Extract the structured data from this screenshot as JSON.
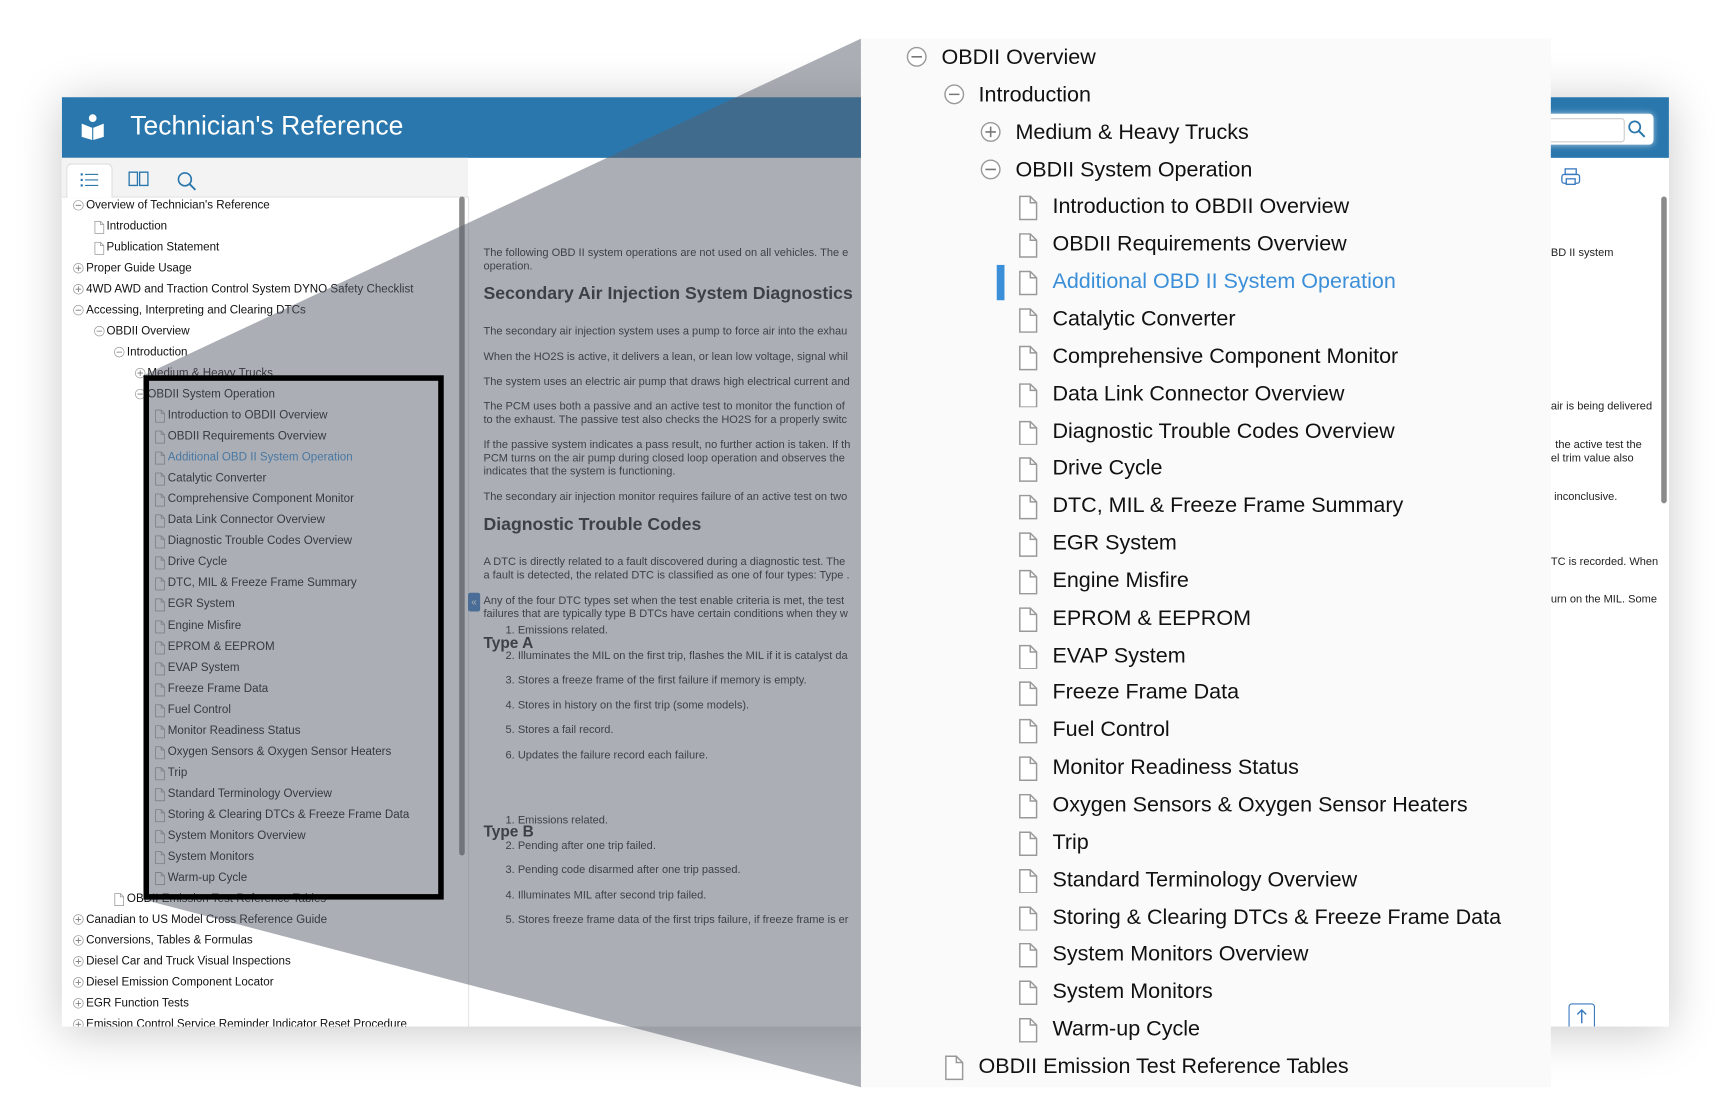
{
  "app": {
    "title": "Technician's Reference",
    "accent": "#2a77ad",
    "selected_color": "#3b8fd9"
  },
  "toolbar": {
    "tabs": [
      {
        "icon": "list-icon",
        "active": true
      },
      {
        "icon": "book-icon"
      },
      {
        "icon": "search-icon"
      }
    ]
  },
  "tree": [
    {
      "label": "Overview of Technician's Reference",
      "level": 0,
      "icon": "minus"
    },
    {
      "label": "Introduction",
      "level": 1,
      "icon": "doc"
    },
    {
      "label": "Publication Statement",
      "level": 1,
      "icon": "doc"
    },
    {
      "label": "Proper Guide Usage",
      "level": 0,
      "icon": "plus"
    },
    {
      "label": "4WD AWD and Traction Control System DYNO Safety Checklist",
      "level": 0,
      "icon": "plus"
    },
    {
      "label": "Accessing, Interpreting and Clearing DTCs",
      "level": 0,
      "icon": "minus"
    },
    {
      "label": "OBDII Overview",
      "level": 1,
      "icon": "minus"
    },
    {
      "label": "Introduction",
      "level": 2,
      "icon": "minus"
    },
    {
      "label": "Medium & Heavy Trucks",
      "level": 3,
      "icon": "plus"
    },
    {
      "label": "OBDII System Operation",
      "level": 3,
      "icon": "minus"
    },
    {
      "label": "Introduction to OBDII Overview",
      "level": 4,
      "icon": "doc"
    },
    {
      "label": "OBDII Requirements Overview",
      "level": 4,
      "icon": "doc"
    },
    {
      "label": "Additional OBD II System Operation",
      "level": 4,
      "icon": "doc",
      "selected": true
    },
    {
      "label": "Catalytic Converter",
      "level": 4,
      "icon": "doc"
    },
    {
      "label": "Comprehensive Component Monitor",
      "level": 4,
      "icon": "doc"
    },
    {
      "label": "Data Link Connector Overview",
      "level": 4,
      "icon": "doc"
    },
    {
      "label": "Diagnostic Trouble Codes Overview",
      "level": 4,
      "icon": "doc"
    },
    {
      "label": "Drive Cycle",
      "level": 4,
      "icon": "doc"
    },
    {
      "label": "DTC, MIL & Freeze Frame Summary",
      "level": 4,
      "icon": "doc"
    },
    {
      "label": "EGR System",
      "level": 4,
      "icon": "doc"
    },
    {
      "label": "Engine Misfire",
      "level": 4,
      "icon": "doc"
    },
    {
      "label": "EPROM & EEPROM",
      "level": 4,
      "icon": "doc"
    },
    {
      "label": "EVAP System",
      "level": 4,
      "icon": "doc"
    },
    {
      "label": "Freeze Frame Data",
      "level": 4,
      "icon": "doc"
    },
    {
      "label": "Fuel Control",
      "level": 4,
      "icon": "doc"
    },
    {
      "label": "Monitor Readiness Status",
      "level": 4,
      "icon": "doc"
    },
    {
      "label": "Oxygen Sensors & Oxygen Sensor Heaters",
      "level": 4,
      "icon": "doc"
    },
    {
      "label": "Trip",
      "level": 4,
      "icon": "doc"
    },
    {
      "label": "Standard Terminology Overview",
      "level": 4,
      "icon": "doc"
    },
    {
      "label": "Storing & Clearing DTCs & Freeze Frame Data",
      "level": 4,
      "icon": "doc"
    },
    {
      "label": "System Monitors Overview",
      "level": 4,
      "icon": "doc"
    },
    {
      "label": "System Monitors",
      "level": 4,
      "icon": "doc"
    },
    {
      "label": "Warm-up Cycle",
      "level": 4,
      "icon": "doc"
    },
    {
      "label": "OBDII Emission Test Reference Tables",
      "level": 2,
      "icon": "doc"
    },
    {
      "label": "Canadian to US Model Cross Reference Guide",
      "level": 0,
      "icon": "plus"
    },
    {
      "label": "Conversions, Tables & Formulas",
      "level": 0,
      "icon": "plus"
    },
    {
      "label": "Diesel Car and Truck Visual Inspections",
      "level": 0,
      "icon": "plus"
    },
    {
      "label": "Diesel Emission Component Locator",
      "level": 0,
      "icon": "plus"
    },
    {
      "label": "EGR Function Tests",
      "level": 0,
      "icon": "plus"
    },
    {
      "label": "Emission Control Service Reminder Indicator Reset Procedure",
      "level": 0,
      "icon": "plus"
    }
  ],
  "content": {
    "intro": "The following OBD II system operations are not used on all vehicles. The e",
    "intro2": "operation.",
    "h_sai": "Secondary Air Injection System Diagnostics",
    "p1": "The secondary air injection system uses a pump to force air into the exhau",
    "p2": "When the HO2S is active, it delivers a lean, or lean low voltage, signal whil",
    "p3": "The system uses an electric air pump that draws high electrical current and",
    "p4a": "The PCM uses both a passive and an active test to monitor the function of",
    "p4b": "to the exhaust. The passive test also checks the HO2S for a properly switc",
    "p5a": "If the passive system indicates a pass result, no further action is taken. If th",
    "p5b": "PCM turns on the air pump during closed loop operation and observes the",
    "p5c": "indicates that the system is functioning.",
    "p6": "The secondary air injection monitor requires failure of an active test on two",
    "h_dtc": "Diagnostic Trouble Codes",
    "p7a": "A DTC is directly related to a fault discovered during a diagnostic test. The",
    "p7b": "a fault is detected, the related DTC is classified as one of four types: Type .",
    "p8a": "Any of the four DTC types set when the test enable criteria is met, the test",
    "p8b": "failures that are typically type B DTCs have certain conditions when they w",
    "h_a": "Type A",
    "type_a": [
      "1. Emissions related.",
      "2. Illuminates the MIL on the first trip, flashes the MIL if it is catalyst da",
      "3. Stores a freeze frame of the first failure if memory is empty.",
      "4. Stores in history on the first trip (some models).",
      "5. Stores a fail record.",
      "6. Updates the failure record each failure."
    ],
    "h_b": "Type B",
    "type_b": [
      "1. Emissions related.",
      "2. Pending after one trip failed.",
      "3. Pending code disarmed after one trip passed.",
      "4. Illuminates MIL after second trip failed.",
      "5. Stores freeze frame data of the first trips failure, if freeze frame is er"
    ],
    "collapse_label": "«"
  },
  "right_snippets": [
    "BD II system",
    "air is being delivered",
    "the active test the",
    "el trim value also",
    "inconclusive.",
    "TC is recorded. When",
    "urn on the MIL. Some"
  ]
}
